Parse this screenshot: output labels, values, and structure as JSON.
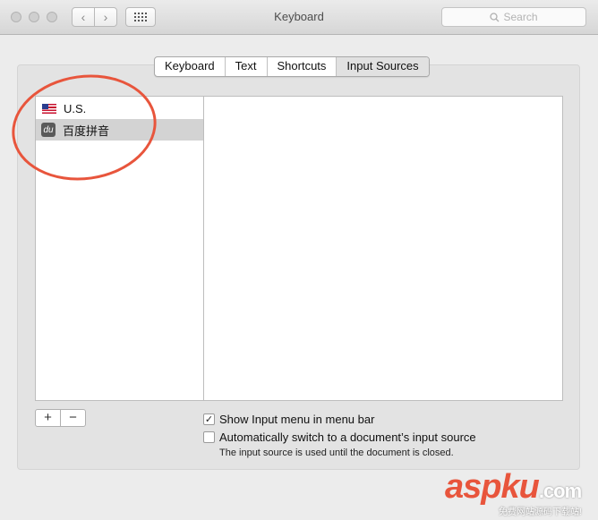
{
  "window": {
    "title": "Keyboard"
  },
  "search": {
    "placeholder": "Search"
  },
  "tabs": [
    {
      "label": "Keyboard"
    },
    {
      "label": "Text"
    },
    {
      "label": "Shortcuts"
    },
    {
      "label": "Input Sources",
      "selected": true
    }
  ],
  "input_sources": [
    {
      "label": "U.S.",
      "icon": "us-flag-icon"
    },
    {
      "label": "百度拼音",
      "icon": "baidu-du-icon",
      "icon_text": "du",
      "selected": true
    }
  ],
  "buttons": {
    "add_label": "+",
    "remove_label": "−"
  },
  "options": {
    "show_menu": {
      "label": "Show Input menu in menu bar",
      "checked": true
    },
    "auto_switch": {
      "label": "Automatically switch to a document’s input source",
      "checked": false
    }
  },
  "note": "The input source is used until the document is closed.",
  "watermark": {
    "brand": "aspku",
    "suffix": ".com",
    "sub": "免费网站源码下载站!"
  },
  "colors": {
    "annotation": "#e8553c",
    "selected_row": "#d3d3d3"
  }
}
